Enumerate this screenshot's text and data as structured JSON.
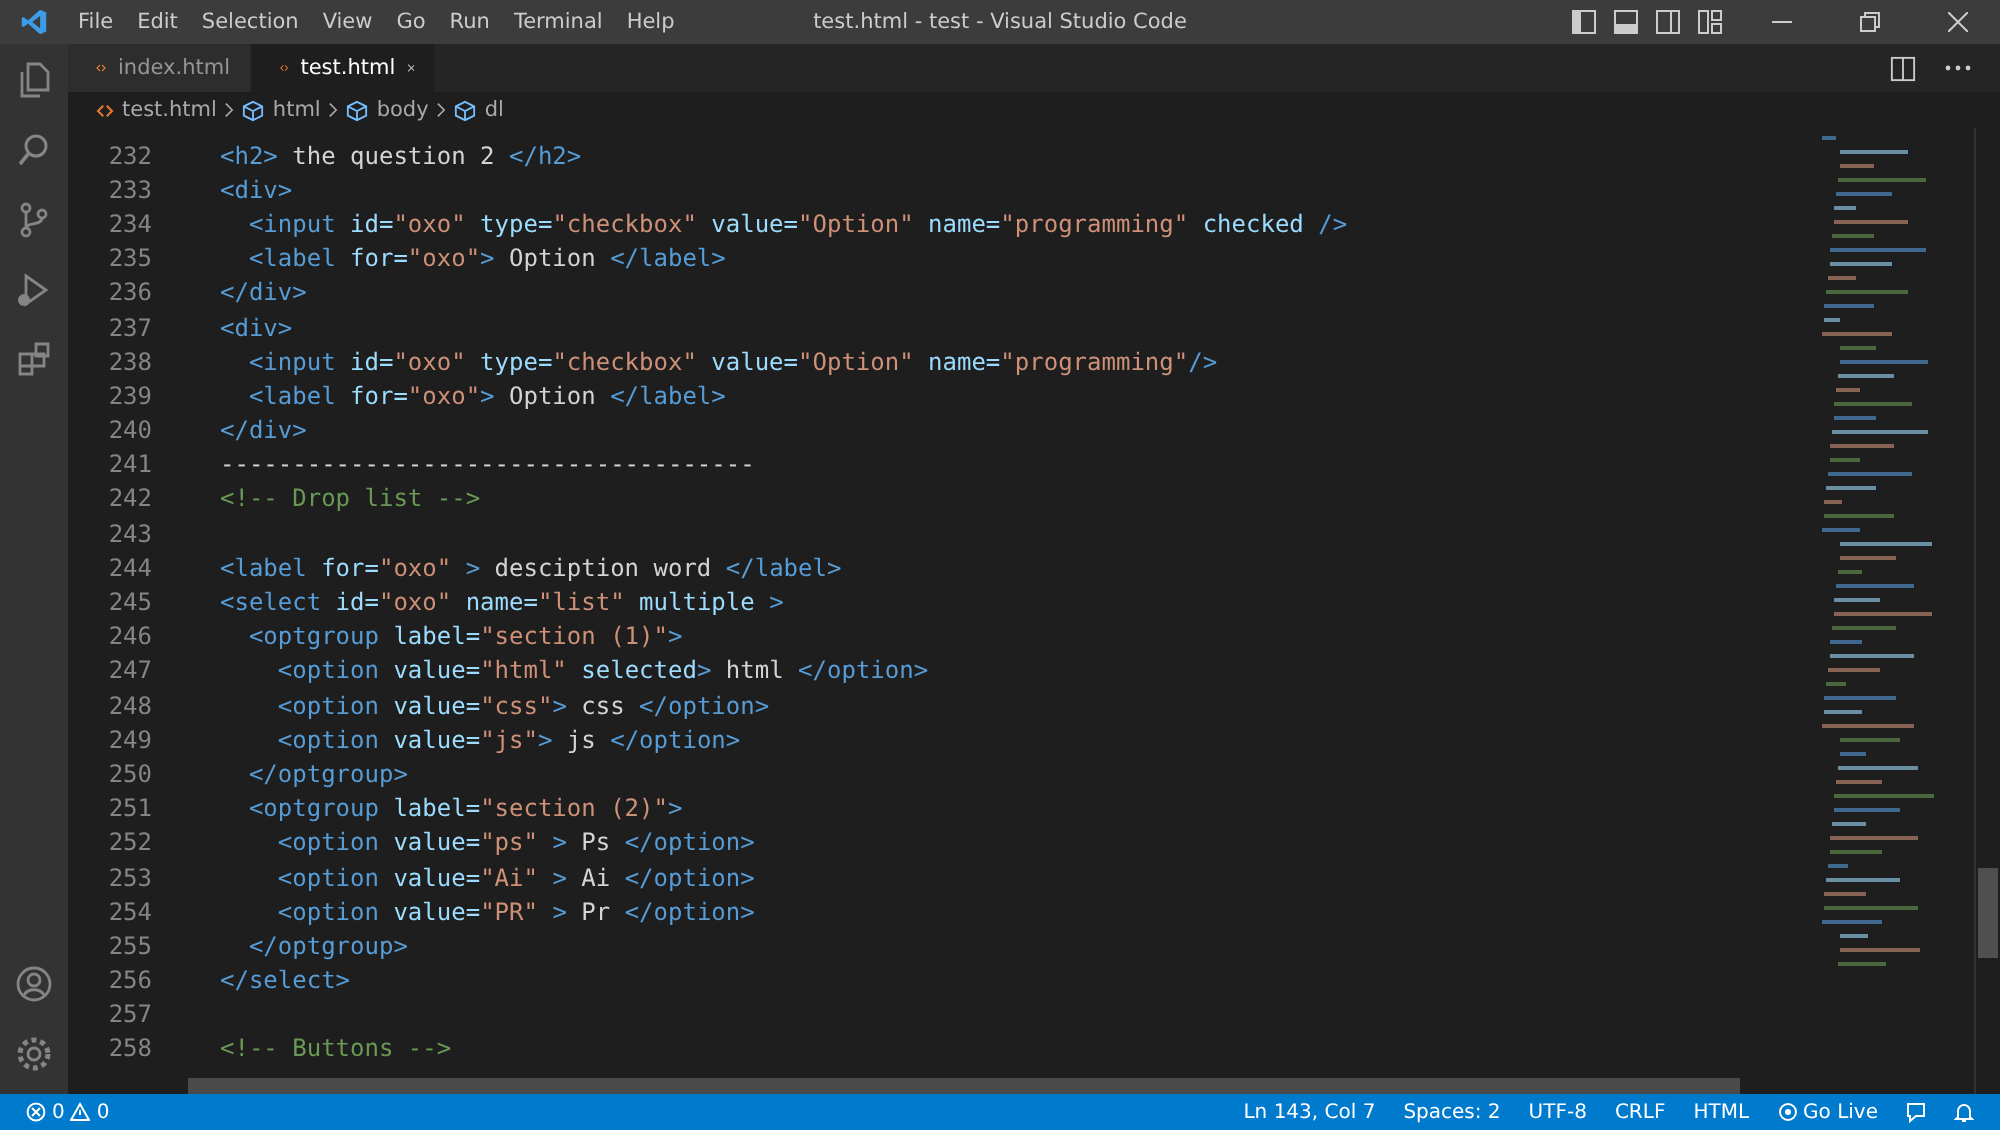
{
  "window": {
    "title": "test.html - test - Visual Studio Code"
  },
  "menu": [
    "File",
    "Edit",
    "Selection",
    "View",
    "Go",
    "Run",
    "Terminal",
    "Help"
  ],
  "tabs": [
    {
      "label": "index.html",
      "selected": false
    },
    {
      "label": "test.html",
      "selected": true
    }
  ],
  "breadcrumbs": [
    {
      "kind": "file",
      "label": "test.html"
    },
    {
      "kind": "element",
      "label": "html"
    },
    {
      "kind": "element",
      "label": "body"
    },
    {
      "kind": "element",
      "label": "dl"
    }
  ],
  "editor": {
    "lines": [
      {
        "number": "232",
        "tokens": [
          {
            "kind": "tag",
            "text": "<h2>"
          },
          {
            "kind": "plain",
            "text": " the question 2 "
          },
          {
            "kind": "tag",
            "text": "</h2>"
          }
        ]
      },
      {
        "number": "233",
        "tokens": [
          {
            "kind": "tag",
            "text": "<div>"
          }
        ]
      },
      {
        "number": "234",
        "tokens": [
          {
            "kind": "tag",
            "text": "  <input"
          },
          {
            "kind": "attr",
            "text": " id="
          },
          {
            "kind": "str",
            "text": "\"oxo\""
          },
          {
            "kind": "attr",
            "text": " type="
          },
          {
            "kind": "str",
            "text": "\"checkbox\""
          },
          {
            "kind": "attr",
            "text": " value="
          },
          {
            "kind": "str",
            "text": "\"Option\""
          },
          {
            "kind": "attr",
            "text": " name="
          },
          {
            "kind": "str",
            "text": "\"programming\""
          },
          {
            "kind": "attr",
            "text": " checked"
          },
          {
            "kind": "tag",
            "text": " />"
          }
        ]
      },
      {
        "number": "235",
        "tokens": [
          {
            "kind": "tag",
            "text": "  <label"
          },
          {
            "kind": "attr",
            "text": " for="
          },
          {
            "kind": "str",
            "text": "\"oxo\""
          },
          {
            "kind": "tag",
            "text": ">"
          },
          {
            "kind": "plain",
            "text": " Option "
          },
          {
            "kind": "tag",
            "text": "</label>"
          }
        ]
      },
      {
        "number": "236",
        "tokens": [
          {
            "kind": "tag",
            "text": "</div>"
          }
        ]
      },
      {
        "number": "237",
        "tokens": [
          {
            "kind": "tag",
            "text": "<div>"
          }
        ]
      },
      {
        "number": "238",
        "tokens": [
          {
            "kind": "tag",
            "text": "  <input"
          },
          {
            "kind": "attr",
            "text": " id="
          },
          {
            "kind": "str",
            "text": "\"oxo\""
          },
          {
            "kind": "attr",
            "text": " type="
          },
          {
            "kind": "str",
            "text": "\"checkbox\""
          },
          {
            "kind": "attr",
            "text": " value="
          },
          {
            "kind": "str",
            "text": "\"Option\""
          },
          {
            "kind": "attr",
            "text": " name="
          },
          {
            "kind": "str",
            "text": "\"programming\""
          },
          {
            "kind": "tag",
            "text": "/>"
          }
        ]
      },
      {
        "number": "239",
        "tokens": [
          {
            "kind": "tag",
            "text": "  <label"
          },
          {
            "kind": "attr",
            "text": " for="
          },
          {
            "kind": "str",
            "text": "\"oxo\""
          },
          {
            "kind": "tag",
            "text": ">"
          },
          {
            "kind": "plain",
            "text": " Option "
          },
          {
            "kind": "tag",
            "text": "</label>"
          }
        ]
      },
      {
        "number": "240",
        "tokens": [
          {
            "kind": "tag",
            "text": "</div>"
          }
        ]
      },
      {
        "number": "241",
        "tokens": [
          {
            "kind": "plain",
            "text": "-------------------------------------"
          }
        ]
      },
      {
        "number": "242",
        "tokens": [
          {
            "kind": "comment",
            "text": "<!-- Drop list -->"
          }
        ]
      },
      {
        "number": "243"
      },
      {
        "number": "244",
        "tokens": [
          {
            "kind": "tag",
            "text": "<label"
          },
          {
            "kind": "attr",
            "text": " for="
          },
          {
            "kind": "str",
            "text": "\"oxo\""
          },
          {
            "kind": "tag",
            "text": " >"
          },
          {
            "kind": "plain",
            "text": " desciption word "
          },
          {
            "kind": "tag",
            "text": "</label>"
          }
        ]
      },
      {
        "number": "245",
        "tokens": [
          {
            "kind": "tag",
            "text": "<select"
          },
          {
            "kind": "attr",
            "text": " id="
          },
          {
            "kind": "str",
            "text": "\"oxo\""
          },
          {
            "kind": "attr",
            "text": " name="
          },
          {
            "kind": "str",
            "text": "\"list\""
          },
          {
            "kind": "attr",
            "text": " multiple"
          },
          {
            "kind": "tag",
            "text": " >"
          }
        ]
      },
      {
        "number": "246",
        "tokens": [
          {
            "kind": "tag",
            "text": "  <optgroup"
          },
          {
            "kind": "attr",
            "text": " label="
          },
          {
            "kind": "str",
            "text": "\"section (1)\""
          },
          {
            "kind": "tag",
            "text": ">"
          }
        ]
      },
      {
        "number": "247",
        "tokens": [
          {
            "kind": "tag",
            "text": "    <option"
          },
          {
            "kind": "attr",
            "text": " value="
          },
          {
            "kind": "str",
            "text": "\"html\""
          },
          {
            "kind": "attr",
            "text": " selected"
          },
          {
            "kind": "tag",
            "text": ">"
          },
          {
            "kind": "plain",
            "text": " html "
          },
          {
            "kind": "tag",
            "text": "</option>"
          }
        ]
      },
      {
        "number": "248",
        "tokens": [
          {
            "kind": "tag",
            "text": "    <option"
          },
          {
            "kind": "attr",
            "text": " value="
          },
          {
            "kind": "str",
            "text": "\"css\""
          },
          {
            "kind": "tag",
            "text": ">"
          },
          {
            "kind": "plain",
            "text": " css "
          },
          {
            "kind": "tag",
            "text": "</option>"
          }
        ]
      },
      {
        "number": "249",
        "tokens": [
          {
            "kind": "tag",
            "text": "    <option"
          },
          {
            "kind": "attr",
            "text": " value="
          },
          {
            "kind": "str",
            "text": "\"js\""
          },
          {
            "kind": "tag",
            "text": ">"
          },
          {
            "kind": "plain",
            "text": " js "
          },
          {
            "kind": "tag",
            "text": "</option>"
          }
        ]
      },
      {
        "number": "250",
        "tokens": [
          {
            "kind": "tag",
            "text": "  </optgroup>"
          }
        ]
      },
      {
        "number": "251",
        "tokens": [
          {
            "kind": "tag",
            "text": "  <optgroup"
          },
          {
            "kind": "attr",
            "text": " label="
          },
          {
            "kind": "str",
            "text": "\"section (2)\""
          },
          {
            "kind": "tag",
            "text": ">"
          }
        ]
      },
      {
        "number": "252",
        "tokens": [
          {
            "kind": "tag",
            "text": "    <option"
          },
          {
            "kind": "attr",
            "text": " value="
          },
          {
            "kind": "str",
            "text": "\"ps\""
          },
          {
            "kind": "tag",
            "text": " >"
          },
          {
            "kind": "plain",
            "text": " Ps "
          },
          {
            "kind": "tag",
            "text": "</option>"
          }
        ]
      },
      {
        "number": "253",
        "tokens": [
          {
            "kind": "tag",
            "text": "    <option"
          },
          {
            "kind": "attr",
            "text": " value="
          },
          {
            "kind": "str",
            "text": "\"Ai\""
          },
          {
            "kind": "tag",
            "text": " >"
          },
          {
            "kind": "plain",
            "text": " Ai "
          },
          {
            "kind": "tag",
            "text": "</option>"
          }
        ]
      },
      {
        "number": "254",
        "tokens": [
          {
            "kind": "tag",
            "text": "    <option"
          },
          {
            "kind": "attr",
            "text": " value="
          },
          {
            "kind": "str",
            "text": "\"PR\""
          },
          {
            "kind": "tag",
            "text": " >"
          },
          {
            "kind": "plain",
            "text": " Pr "
          },
          {
            "kind": "tag",
            "text": "</option>"
          }
        ]
      },
      {
        "number": "255",
        "tokens": [
          {
            "kind": "tag",
            "text": "  </optgroup>"
          }
        ]
      },
      {
        "number": "256",
        "tokens": [
          {
            "kind": "tag",
            "text": "</select>"
          }
        ]
      },
      {
        "number": "257"
      },
      {
        "number": "258",
        "tokens": [
          {
            "kind": "comment",
            "text": "<!-- Buttons -->"
          }
        ]
      }
    ]
  },
  "status_bar": {
    "errors": "0",
    "warnings": "0",
    "items": [
      {
        "kind": "text",
        "label": "Ln 143, Col 7"
      },
      {
        "kind": "text",
        "label": "Spaces: 2"
      },
      {
        "kind": "text",
        "label": "UTF-8"
      },
      {
        "kind": "text",
        "label": "CRLF"
      },
      {
        "kind": "text",
        "label": "HTML"
      },
      {
        "kind": "live",
        "label": "Go Live"
      }
    ]
  }
}
